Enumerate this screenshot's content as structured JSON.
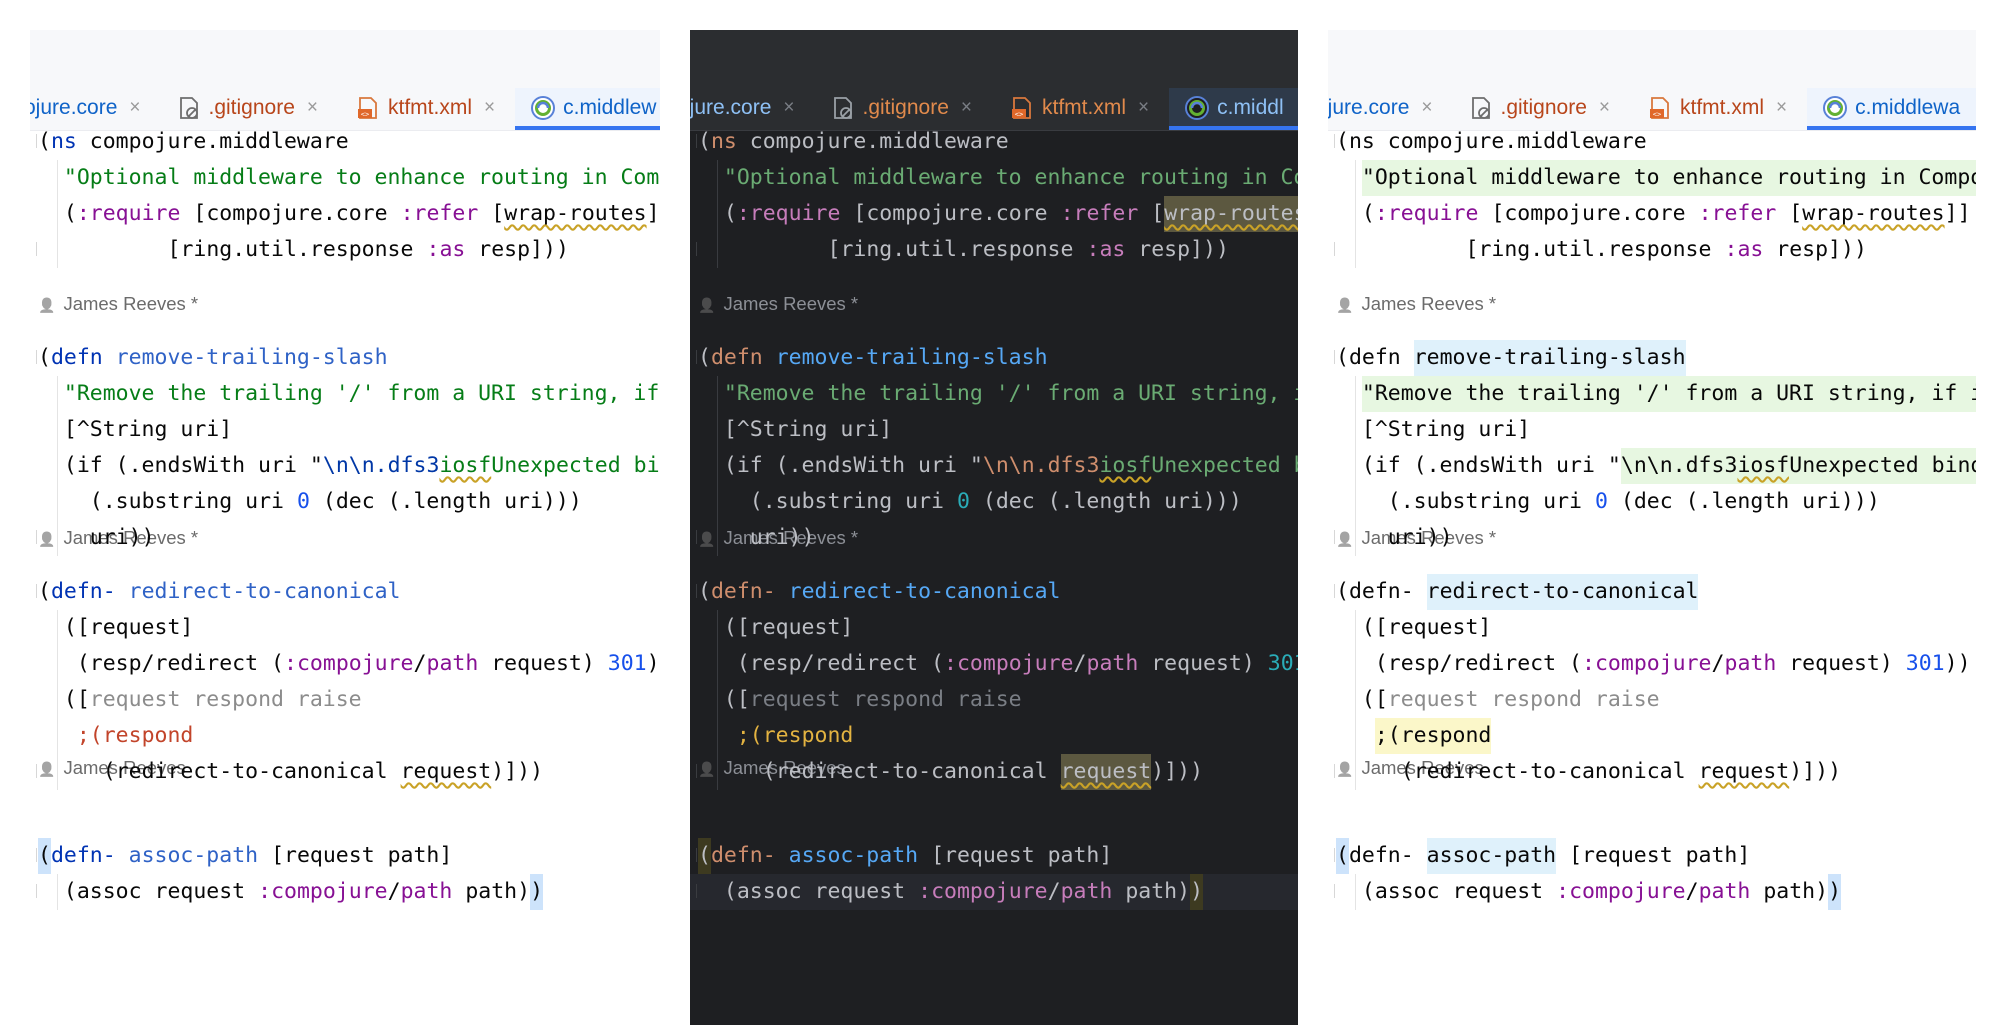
{
  "tabs": [
    {
      "label": "ojure.core",
      "icon": "clojure-file-icon",
      "kind": "clj"
    },
    {
      "label": ".gitignore",
      "icon": "gitignore-file-icon",
      "kind": "git"
    },
    {
      "label": "ktfmt.xml",
      "icon": "xml-file-icon",
      "kind": "xml"
    }
  ],
  "active_tab": {
    "icon": "clojure-file-icon",
    "labels": [
      "c.middlew",
      "c.middl",
      "c.middlewa"
    ]
  },
  "close_glyph": "×",
  "author_icon": "person-icon",
  "authors": {
    "a1": "James Reeves *",
    "a2": "James Reeves *",
    "a3": "James Reeves"
  },
  "code": {
    "l1": {
      "paren": "(",
      "kw": "ns",
      "rest": " compojure.middleware"
    },
    "l2": {
      "indent": "  ",
      "str": "\"Optional middleware to enhance routing in Compojure.\""
    },
    "l3": {
      "indent": "  ",
      "p": "(",
      "kwd": ":require",
      "a": " [compojure.core ",
      "kwd2": ":refer",
      "b": " [",
      "c": "wrap-routes",
      "d": "]]"
    },
    "l4": {
      "indent": "          ",
      "a": "[ring.util.response ",
      "kwd": ":as",
      "b": " resp]))"
    },
    "l5": {
      "p": "(",
      "kw": "defn",
      "fn": "remove-trailing-slash"
    },
    "l6": {
      "indent": "  ",
      "str": "\"Remove the trailing '/' from a URI string, if it exists.\""
    },
    "l7": {
      "indent": "  ",
      "txt": "[^String uri]"
    },
    "l8": {
      "indent": "  ",
      "a": "(if (.endsWith uri \"",
      "esc": "\\n\\n.dfs3",
      "wavy": "iosf",
      "tail": "Unexpected binding\")"
    },
    "l9": {
      "indent": "    ",
      "a": "(.substring uri ",
      "num": "0",
      "b": " (dec (.length uri)))"
    },
    "l10": {
      "indent": "    ",
      "txt": "uri))"
    },
    "l11": {
      "p": "(",
      "kw": "defn-",
      "fn": "redirect-to-canonical"
    },
    "l12": {
      "indent": "  ",
      "txt": "([request]"
    },
    "l13": {
      "indent": "   ",
      "a": "(resp/redirect (",
      "kwd": ":compojure",
      "sl": "/",
      "kwd2": "path",
      "b": " request) ",
      "num": "301",
      "c": "))"
    },
    "l14": {
      "indent": "  ",
      "a": "([",
      "c": "request respond raise"
    },
    "l15": {
      "indent": "   ",
      "cmt": ";(respond"
    },
    "l16": {
      "indent": "     ",
      "a": "(redirect-to-canonical ",
      "req": "request",
      "b": ")]))"
    },
    "l17": {
      "p": "(",
      "kw": "defn-",
      "fn": "assoc-path",
      "rest": " [request path]"
    },
    "l18": {
      "indent": "  ",
      "a": "(assoc request ",
      "kwd": ":compojure",
      "sl": "/",
      "kwd2": "path",
      "b": " path)",
      "close": ")"
    }
  }
}
